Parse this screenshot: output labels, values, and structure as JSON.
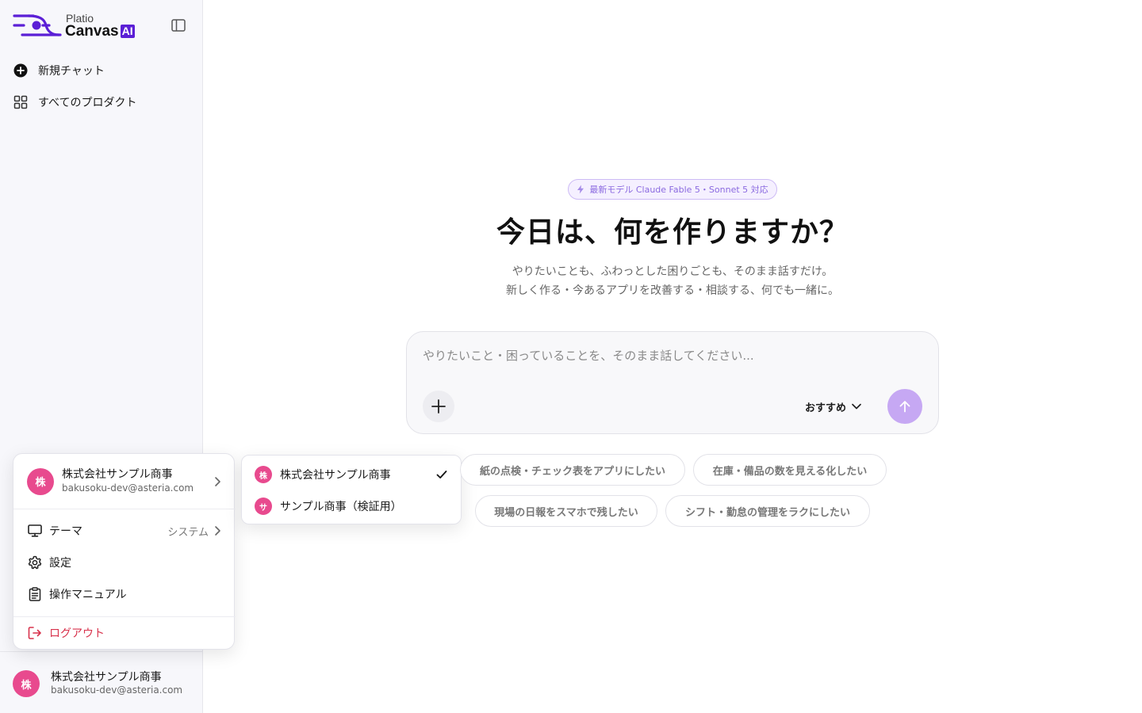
{
  "brand": {
    "small": "Platio",
    "big": "Canvas",
    "ai": "AI",
    "colors": {
      "primary": "#5b1fd6",
      "accent": "#c6a8f3",
      "avatar": "#e84a8e",
      "danger": "#d8324c"
    }
  },
  "sidebar": {
    "toggle_icon": "sidebar-toggle-icon",
    "items": [
      {
        "label": "新規チャット",
        "icon": "plus-circle-icon"
      },
      {
        "label": "すべてのプロダクト",
        "icon": "grid-icon"
      }
    ],
    "user": {
      "avatar": "株",
      "name": "株式会社サンプル商事",
      "email": "bakusoku-dev@asteria.com"
    }
  },
  "account_menu": {
    "account": {
      "avatar": "株",
      "name": "株式会社サンプル商事",
      "email": "bakusoku-dev@asteria.com"
    },
    "theme": {
      "label": "テーマ",
      "value": "システム"
    },
    "settings": "設定",
    "manual": "操作マニュアル",
    "logout": "ログアウト"
  },
  "org_submenu": [
    {
      "avatar": "株",
      "name": "株式会社サンプル商事",
      "selected": true
    },
    {
      "avatar": "サ",
      "name": "サンプル商事（検証用）",
      "selected": false
    }
  ],
  "main": {
    "badge": "最新モデル Claude Fable 5・Sonnet 5 対応",
    "title": "今日は、何を作りますか？",
    "subtitle_line1": "やりたいことも、ふわっとした困りごとも、そのまま話すだけ。",
    "subtitle_line2": "新しく作る・今あるアプリを改善する・相談する、何でも一緒に。",
    "composer": {
      "placeholder": "やりたいこと・困っていることを、そのまま話してください...",
      "value": "",
      "model": "おすすめ"
    },
    "suggestions": [
      "紙の点検・チェック表をアプリにしたい",
      "在庫・備品の数を見える化したい",
      "現場の日報をスマホで残したい",
      "シフト・勤怠の管理をラクにしたい"
    ]
  }
}
